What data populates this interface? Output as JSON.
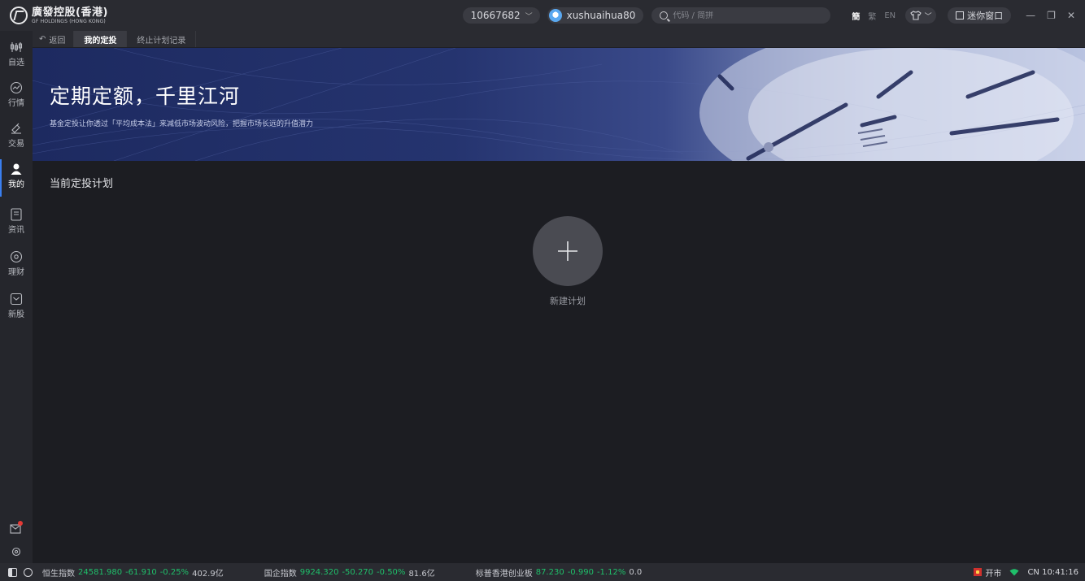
{
  "app": {
    "logo_cn": "廣發控股(香港)",
    "logo_en": "GF HOLDINGS (HONG KONG)"
  },
  "titlebar": {
    "account": "10667682",
    "username": "xushuaihua80",
    "search_placeholder": "代码 / 简拼",
    "lang_simplified": "簡",
    "lang_traditional": "繁",
    "lang_en": "EN",
    "mini_window": "迷你窗口"
  },
  "sidebar": {
    "items": [
      {
        "label": "自选",
        "icon": "watchlist-icon"
      },
      {
        "label": "行情",
        "icon": "market-icon"
      },
      {
        "label": "交易",
        "icon": "trade-icon"
      },
      {
        "label": "我的",
        "icon": "user-icon"
      },
      {
        "label": "资讯",
        "icon": "news-icon"
      },
      {
        "label": "理财",
        "icon": "wealth-icon"
      },
      {
        "label": "新股",
        "icon": "ipo-icon"
      }
    ],
    "active_index": 3
  },
  "tabs": {
    "back": "返回",
    "items": [
      "我的定投",
      "终止计划记录"
    ],
    "active_index": 0
  },
  "banner": {
    "title": "定期定额，千里江河",
    "subtitle": "基金定投让你透过「平均成本法」来减低市场波动风险，把握市场长远的升值潜力"
  },
  "main": {
    "section_title": "当前定投计划",
    "new_plan_label": "新建计划"
  },
  "statusbar": {
    "indices": [
      {
        "name": "恒生指数",
        "price": "24581.980",
        "change": "-61.910",
        "pct": "-0.25%",
        "volume": "402.9亿"
      },
      {
        "name": "国企指数",
        "price": "9924.320",
        "change": "-50.270",
        "pct": "-0.50%",
        "volume": "81.6亿"
      },
      {
        "name": "标普香港创业板",
        "price": "87.230",
        "change": "-0.990",
        "pct": "-1.12%",
        "volume": "0.0"
      }
    ],
    "market_status": "开市",
    "clock": "CN 10:41:16"
  },
  "colors": {
    "down": "#1fbf6a",
    "accent": "#3a7ff0"
  }
}
